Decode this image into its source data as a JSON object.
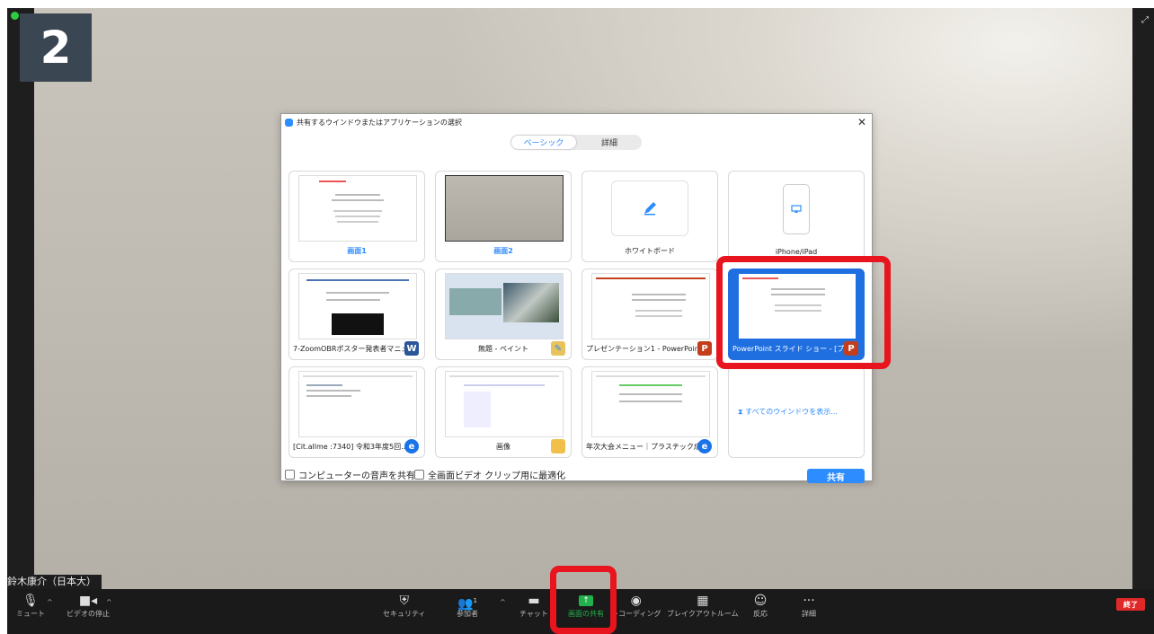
{
  "screen_number": "2",
  "presenter_name": "鈴木康介（日本大）",
  "dialog": {
    "title": "共有するウインドウまたはアプリケーションの選択",
    "tabs": [
      {
        "label": "ベーシック",
        "active": true
      },
      {
        "label": "詳細",
        "active": false
      }
    ],
    "tiles": [
      {
        "label": "画面1",
        "style": "blue"
      },
      {
        "label": "画面2",
        "style": "blue"
      },
      {
        "label": "ホワイトボード"
      },
      {
        "label": "iPhone/iPad"
      },
      {
        "label": "7-ZoomOBRポスター発表者マニュ...",
        "badge": "W"
      },
      {
        "label": "無題 - ペイント"
      },
      {
        "label": "プレゼンテーション1 - PowerPoint",
        "badge": "P"
      },
      {
        "label": "PowerPoint スライド ショー - [プレ...",
        "badge": "P",
        "selected": true
      },
      {
        "label": "[Cit.allme :7340] 令和3年度5回..."
      },
      {
        "label": "画像"
      },
      {
        "label": "年次大会メニュー｜プラスチック成..."
      }
    ],
    "show_all_windows": "すべてのウインドウを表示...",
    "share_audio": "コンピューターの音声を共有",
    "optimize_video": "全画面ビデオ クリップ用に最適化",
    "share_button": "共有"
  },
  "toolbar": {
    "mute": "ミュート",
    "stop_video": "ビデオの停止",
    "security": "セキュリティ",
    "participants": "参加者",
    "participants_count": "1",
    "chat": "チャット",
    "share_screen": "画面の共有",
    "record": "レコーディング",
    "breakout": "ブレイクアウトルーム",
    "reactions": "反応",
    "more": "詳細",
    "end": "終了"
  },
  "colors": {
    "accent": "#2d8cff",
    "highlight": "#e8141e",
    "share_green": "#22b14c",
    "end_red": "#e02828"
  }
}
